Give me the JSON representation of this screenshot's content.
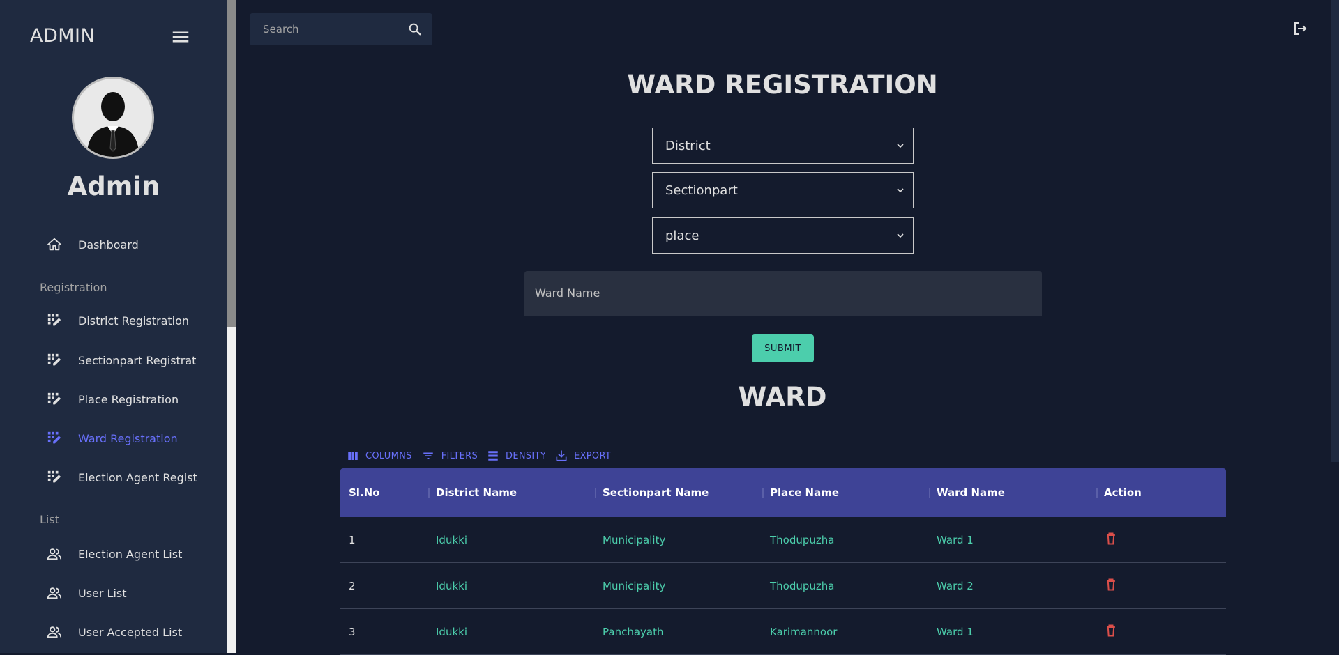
{
  "sidebar": {
    "brand": "ADMIN",
    "user_name": "Admin",
    "items": [
      {
        "label": "Dashboard",
        "icon": "home-icon"
      },
      {
        "label": "District Registration",
        "icon": "app-registration-icon"
      },
      {
        "label": "Sectionpart Registration",
        "icon": "app-registration-icon"
      },
      {
        "label": "Place Registration",
        "icon": "app-registration-icon"
      },
      {
        "label": "Ward Registration",
        "icon": "app-registration-icon",
        "active": true
      },
      {
        "label": "Election Agent Registration",
        "icon": "app-registration-icon"
      },
      {
        "label": "Election Agent List",
        "icon": "people-icon"
      },
      {
        "label": "User List",
        "icon": "people-icon"
      },
      {
        "label": "User Accepted List",
        "icon": "people-icon"
      }
    ],
    "sections": {
      "registration": "Registration",
      "list": "List"
    }
  },
  "topbar": {
    "search_placeholder": "Search"
  },
  "form": {
    "title": "WARD REGISTRATION",
    "district_select": "District",
    "sectionpart_select": "Sectionpart",
    "place_select": "place",
    "ward_name_label": "Ward Name",
    "submit_label": "SUBMIT"
  },
  "grid": {
    "title": "WARD",
    "toolbar": {
      "columns": "COLUMNS",
      "filters": "FILTERS",
      "density": "DENSITY",
      "export": "EXPORT"
    },
    "columns": [
      "Sl.No",
      "District Name",
      "Sectionpart Name",
      "Place Name",
      "Ward Name",
      "Action"
    ],
    "rows": [
      {
        "sl": "1",
        "district": "Idukki",
        "section": "Municipality",
        "place": "Thodupuzha",
        "ward": "Ward 1"
      },
      {
        "sl": "2",
        "district": "Idukki",
        "section": "Municipality",
        "place": "Thodupuzha",
        "ward": "Ward 2"
      },
      {
        "sl": "3",
        "district": "Idukki",
        "section": "Panchayath",
        "place": "Karimannoor",
        "ward": "Ward 1"
      }
    ]
  },
  "colors": {
    "accent": "#6870fa",
    "green": "#4cceac",
    "header": "#3e4396",
    "delete": "#db4f4a"
  }
}
